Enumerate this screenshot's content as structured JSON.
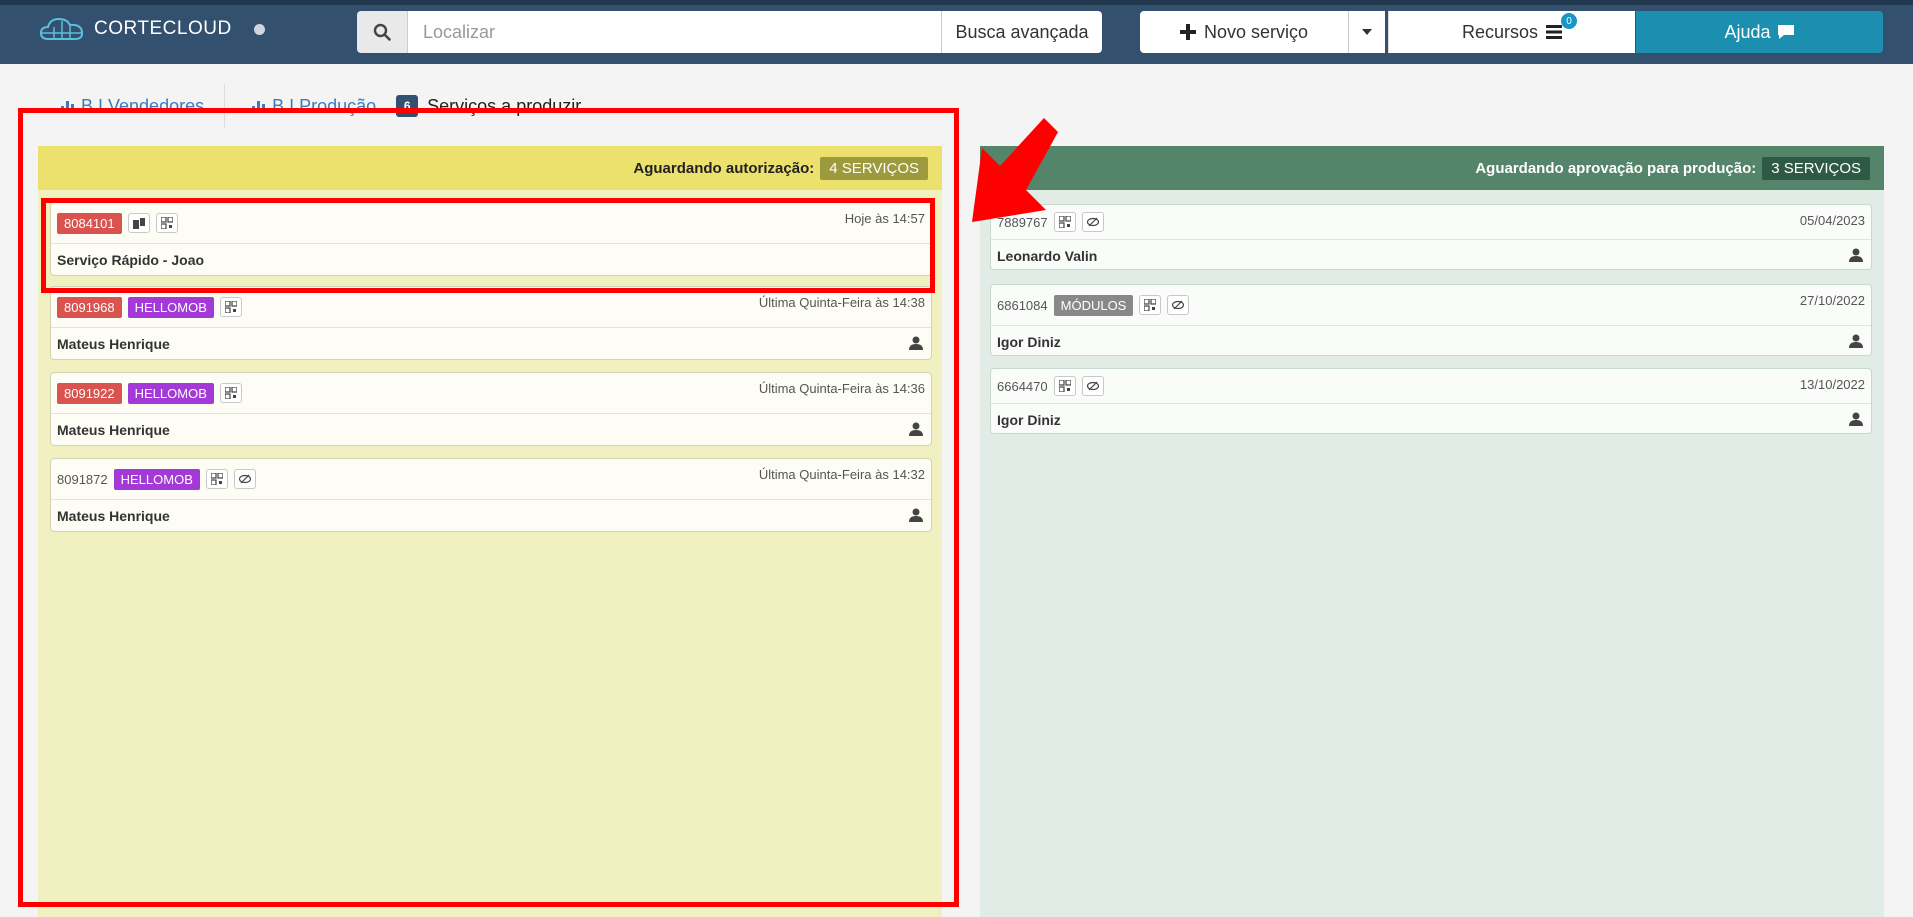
{
  "app": {
    "brand_name": "CORTECLOUD"
  },
  "search": {
    "placeholder": "Localizar",
    "advanced_label": "Busca avançada"
  },
  "header": {
    "novo_servico_label": "Novo serviço",
    "recursos_label": "Recursos",
    "recursos_badge": "0",
    "ajuda_label": "Ajuda"
  },
  "tabs": [
    {
      "label": "B.I Vendedores"
    },
    {
      "label": "B.I Produção"
    },
    {
      "label": "Serviços a produzir",
      "count": "6"
    }
  ],
  "columns": [
    {
      "title": "Aguardando autorização:",
      "count_label": "4 SERVIÇOS",
      "cards": [
        {
          "id": "8084101",
          "date": "Hoje às 14:57",
          "name": "Serviço Rápido - Joao"
        },
        {
          "id": "8091968",
          "tag": "HELLOMOB",
          "date": "Última Quinta-Feira às 14:38",
          "name": "Mateus Henrique"
        },
        {
          "id": "8091922",
          "tag": "HELLOMOB",
          "date": "Última Quinta-Feira às 14:36",
          "name": "Mateus Henrique"
        },
        {
          "id": "8091872",
          "tag": "HELLOMOB",
          "date": "Última Quinta-Feira às 14:32",
          "name": "Mateus Henrique"
        }
      ]
    },
    {
      "title": "Aguardando aprovação para produção:",
      "count_label": "3 SERVIÇOS",
      "cards": [
        {
          "id": "7889767",
          "date": "05/04/2023",
          "name": "Leonardo Valin"
        },
        {
          "id": "6861084",
          "tag": "MÓDULOS",
          "date": "27/10/2022",
          "name": "Igor Diniz"
        },
        {
          "id": "6664470",
          "date": "13/10/2022",
          "name": "Igor Diniz"
        }
      ]
    }
  ],
  "colors": {
    "navbar": "#33506e",
    "help_button": "#1c8eaf",
    "left_column": "#f1f0c0",
    "left_header": "#ebe16c",
    "right_column": "#e0ece5",
    "right_header": "#548469",
    "id_badge": "#d9534f",
    "hellomob_tag": "#a339d6",
    "annotation": "#ff0000"
  },
  "icons": [
    "cloud-logo-icon",
    "search-icon",
    "plus-icon",
    "caret-down-icon",
    "bars-icon",
    "comment-icon",
    "bar-chart-icon",
    "qrcode-icon",
    "eye-slash-icon",
    "copy-icon",
    "user-icon",
    "red-arrow-annotation"
  ]
}
